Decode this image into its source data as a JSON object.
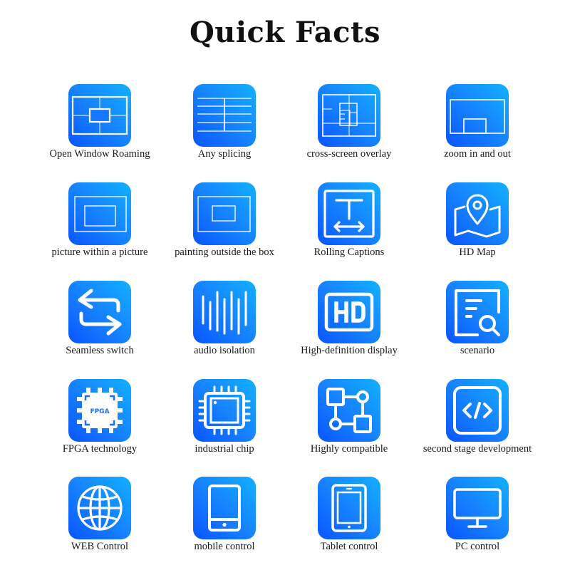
{
  "title": "Quick Facts",
  "theme": {
    "tile_gradient_start": "#0a55ff",
    "tile_gradient_end": "#12b0ff",
    "icon_color": "#ffffff"
  },
  "features": [
    {
      "label": "Open Window Roaming",
      "icon": "window-roaming-icon"
    },
    {
      "label": "Any splicing",
      "icon": "splicing-grid-icon"
    },
    {
      "label": "cross-screen overlay",
      "icon": "cross-screen-overlay-icon"
    },
    {
      "label": "zoom in and out",
      "icon": "zoom-screen-icon"
    },
    {
      "label": "picture within a picture",
      "icon": "picture-in-picture-icon"
    },
    {
      "label": "painting outside the box",
      "icon": "picture-outside-box-icon"
    },
    {
      "label": "Rolling Captions",
      "icon": "rolling-caption-icon"
    },
    {
      "label": "HD Map",
      "icon": "map-pin-icon"
    },
    {
      "label": "Seamless switch",
      "icon": "switch-arrows-icon"
    },
    {
      "label": "audio isolation",
      "icon": "audio-bars-icon"
    },
    {
      "label": "High-definition display",
      "icon": "hd-icon"
    },
    {
      "label": "scenario",
      "icon": "document-search-icon"
    },
    {
      "label": "FPGA technology",
      "icon": "fpga-chip-icon",
      "chip_text": "FPGA"
    },
    {
      "label": "industrial chip",
      "icon": "cpu-chip-icon"
    },
    {
      "label": "Highly compatible",
      "icon": "compatibility-nodes-icon"
    },
    {
      "label": "second stage development",
      "icon": "code-icon"
    },
    {
      "label": "WEB Control",
      "icon": "globe-icon"
    },
    {
      "label": "mobile control",
      "icon": "mobile-phone-icon"
    },
    {
      "label": "Tablet control",
      "icon": "tablet-icon"
    },
    {
      "label": "PC control",
      "icon": "monitor-icon"
    }
  ]
}
